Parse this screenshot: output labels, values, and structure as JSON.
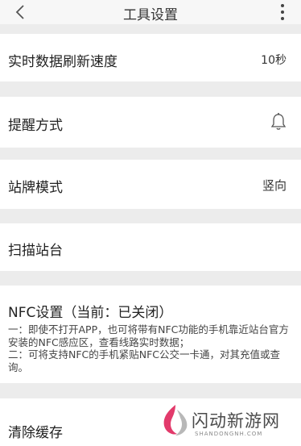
{
  "header": {
    "title": "工具设置",
    "back_icon": "chevron-left-icon",
    "more_icon": "more-vertical-icon"
  },
  "settings": {
    "refresh_speed": {
      "label": "实时数据刷新速度",
      "value": "10秒"
    },
    "reminder": {
      "label": "提醒方式",
      "icon": "bell-icon"
    },
    "stop_board": {
      "label": "站牌模式",
      "value": "竖向"
    },
    "scan": {
      "label": "扫描站台"
    },
    "nfc": {
      "label": "NFC设置（当前：已关闭）",
      "desc1": "一：即使不打开APP，也可将带有NFC功能的手机靠近站台官方安装的NFC感应区，查看线路实时数据；",
      "desc2": "二：可将支持NFC的手机紧贴NFC公交一卡通，对其充值或查询。"
    },
    "clear_cache": {
      "label": "清除缓存"
    }
  },
  "watermark": {
    "text": "闪动新游网",
    "sub": "SHANDONGNH.COM"
  },
  "colors": {
    "background": "#ececec",
    "row": "#ffffff",
    "text": "#222222"
  }
}
